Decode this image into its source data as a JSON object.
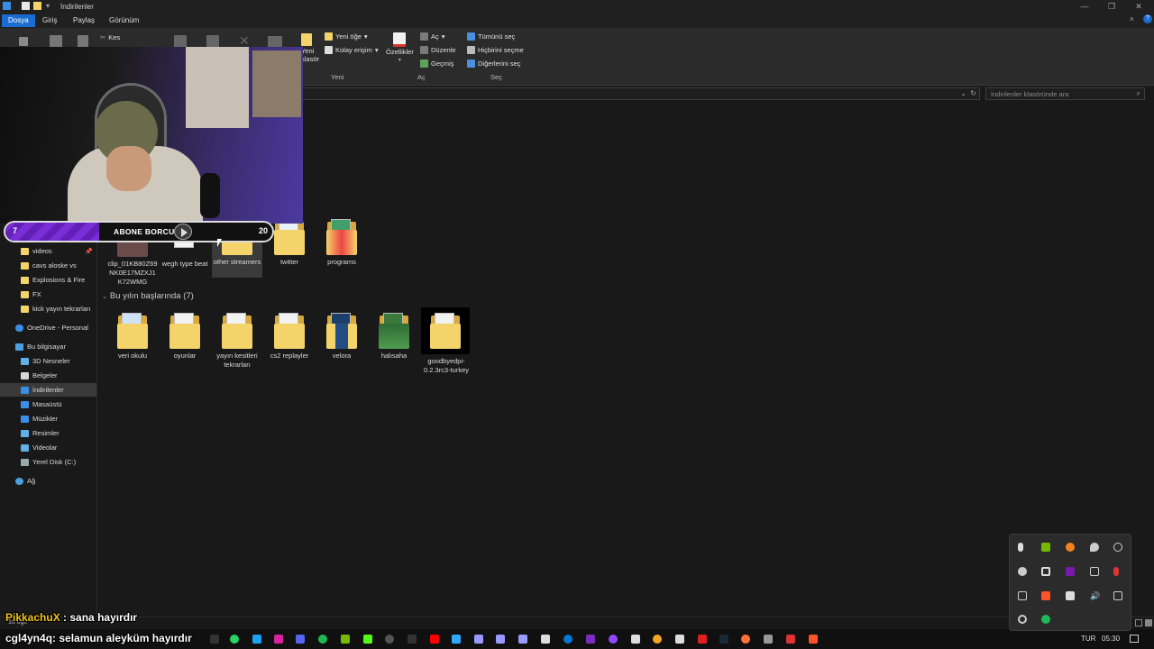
{
  "window": {
    "title": "İndirilenler"
  },
  "ribbon_tabs": [
    "Dosya",
    "Giriş",
    "Paylaş",
    "Görünüm"
  ],
  "ribbon": {
    "clipboard": {
      "cut": "Kes"
    },
    "new": {
      "new_folder_line1": "Yeni",
      "new_folder_line2": "klasör",
      "new_item": "Yeni öğe",
      "easy_access": "Kolay erişim",
      "group": "Yeni"
    },
    "open": {
      "properties": "Özellikler",
      "open": "Aç",
      "edit": "Düzenle",
      "history": "Geçmiş",
      "group": "Aç"
    },
    "select": {
      "select_all": "Tümünü seç",
      "select_none": "Hiçbirini seçme",
      "invert": "Diğerlerini seç",
      "group": "Seç"
    }
  },
  "search": {
    "placeholder": "İndirilenler klasöründe ara"
  },
  "nav": {
    "quick_access": [
      {
        "label": "videos",
        "pinned": true
      },
      {
        "label": "cavs aloske vs",
        "pinned": false
      },
      {
        "label": "Explosions & Fire",
        "pinned": false
      },
      {
        "label": "FX",
        "pinned": false
      },
      {
        "label": "kick yayın tekrarları",
        "pinned": false
      }
    ],
    "onedrive": "OneDrive - Personal",
    "this_pc": "Bu bilgisayar",
    "pc_items": [
      "3D Nesneler",
      "Belgeler",
      "İndirilenler",
      "Masaüstü",
      "Müzikler",
      "Resimler",
      "Videolar",
      "Yerel Disk (C:)"
    ],
    "network": "Ağ"
  },
  "content": {
    "top_items": [
      "clip_01KB80Z69NK0E17MZXJ1K72WMG",
      "wegh type beat",
      "other streamers",
      "twitter",
      "programs"
    ],
    "group_header": "Bu yılın başlarında (7)",
    "group_items": [
      "veri okulu",
      "oyunlar",
      "yayın kesitleri tekrarları",
      "cs2 replayler",
      "velora",
      "halısaha",
      "goodbyedpi-0.2.3rc3-turkey"
    ]
  },
  "status": {
    "count": "16 öğe"
  },
  "overlay": {
    "sub_current": "7",
    "sub_goal": "20",
    "sub_label": "ABONE BORCU",
    "progress": 0.35
  },
  "chat": [
    {
      "user": "PikkachuX",
      "message": ": sana hayırdır"
    },
    {
      "user": "cgl4yn4q",
      "message": ": selamun aleyküm hayırdır"
    }
  ],
  "taskbar": {
    "lang": "TUR",
    "time": "05:30"
  },
  "colors": {
    "accent": "#1a6cd1",
    "folder": "#f5d36b",
    "overlay_purple": "#7a2fd6"
  }
}
